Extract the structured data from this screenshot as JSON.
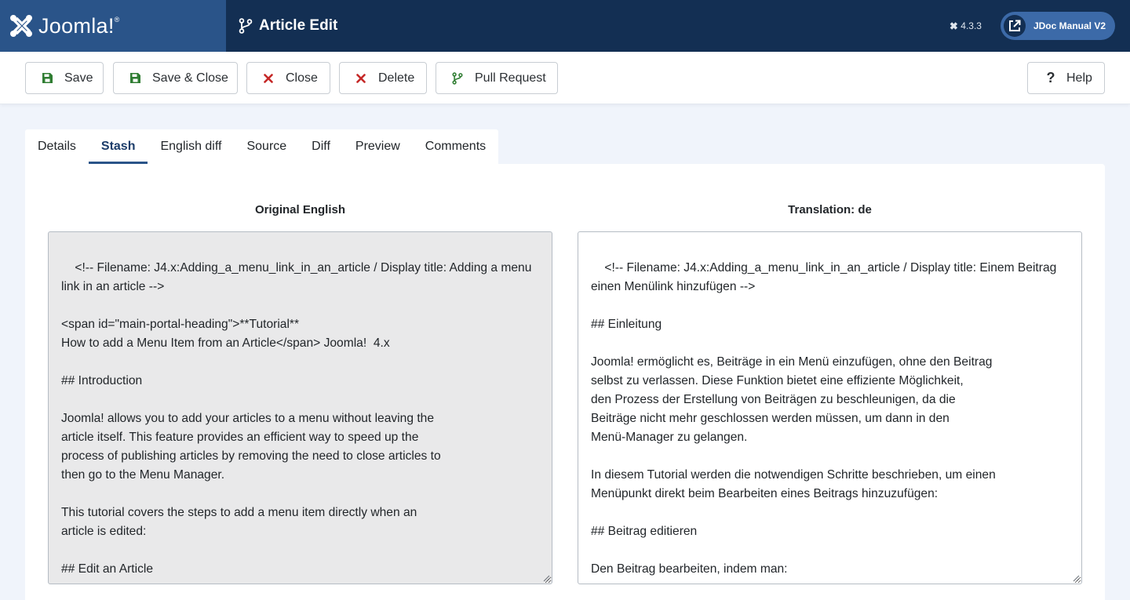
{
  "header": {
    "brand": "Joomla!",
    "brand_mark": "®",
    "page_title": "Article Edit",
    "version": "4.3.3",
    "site_name": "JDoc Manual V2"
  },
  "toolbar": {
    "save": "Save",
    "save_close": "Save & Close",
    "close": "Close",
    "delete": "Delete",
    "pull_request": "Pull Request",
    "help": "Help"
  },
  "tabs": [
    {
      "label": "Details"
    },
    {
      "label": "Stash"
    },
    {
      "label": "English diff"
    },
    {
      "label": "Source"
    },
    {
      "label": "Diff"
    },
    {
      "label": "Preview"
    },
    {
      "label": "Comments"
    }
  ],
  "active_tab": "Stash",
  "columns": {
    "original_heading": "Original English",
    "translation_heading": "Translation: de",
    "original_text": "<!-- Filename: J4.x:Adding_a_menu_link_in_an_article / Display title: Adding a menu link in an article -->\n\n<span id=\"main-portal-heading\">**Tutorial**\nHow to add a Menu Item from an Article</span> Joomla!  4.x\n\n## Introduction\n\nJoomla! allows you to add your articles to a menu without leaving the\narticle itself. This feature provides an efficient way to speed up the\nprocess of publishing articles by removing the need to close articles to\nthen go to the Menu Manager.\n\nThis tutorial covers the steps to add a menu item directly when an\narticle is edited:\n\n## Edit an Article\n\nEdit your article by:",
    "translation_text": "<!-- Filename: J4.x:Adding_a_menu_link_in_an_article / Display title: Einem Beitrag einen Menülink hinzufügen -->\n\n## Einleitung\n\nJoomla! ermöglicht es, Beiträge in ein Menü einzufügen, ohne den Beitrag\nselbst zu verlassen. Diese Funktion bietet eine effiziente Möglichkeit,\nden Prozess der Erstellung von Beiträgen zu beschleunigen, da die\nBeiträge nicht mehr geschlossen werden müssen, um dann in den\nMenü-Manager zu gelangen.\n\nIn diesem Tutorial werden die notwendigen Schritte beschrieben, um einen\nMenüpunkt direkt beim Bearbeiten eines Beitrags hinzuzufügen:\n\n## Beitrag editieren\n\nDen Beitrag bearbeiten, indem man:\n\n- **Inhalt** → **Beiträge** auf den Titel des Beitrags klickt"
  },
  "colors": {
    "header_bg": "#132f53",
    "logo_bg": "#2a5489",
    "save_green": "#2f7d32",
    "close_red": "#c52827"
  }
}
